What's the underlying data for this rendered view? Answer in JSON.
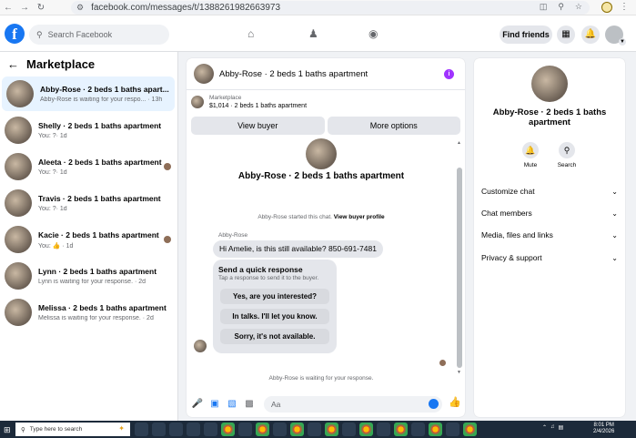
{
  "browser": {
    "url": "facebook.com/messages/t/1388261982663973"
  },
  "header": {
    "search_placeholder": "Search Facebook",
    "find_friends_label": "Find friends"
  },
  "sidebar": {
    "title": "Marketplace",
    "conversations": [
      {
        "name": "Abby-Rose · 2 beds 1 baths apart...",
        "subtitle": "Abby-Rose is waiting for your respo... · 13h",
        "active": true
      },
      {
        "name": "Shelly · 2 beds 1 baths apartment",
        "subtitle": "You: ?· 1d",
        "active": false
      },
      {
        "name": "Aleeta · 2 beds 1 baths apartment",
        "subtitle": "You: ?· 1d",
        "active": false
      },
      {
        "name": "Travis · 2 beds 1 baths apartment",
        "subtitle": "You: ?· 1d",
        "active": false
      },
      {
        "name": "Kacie · 2 beds 1 baths apartment",
        "subtitle": "You: 👍 · 1d",
        "active": false
      },
      {
        "name": "Lynn · 2 beds 1 baths apartment",
        "subtitle": "Lynn is waiting for your response. · 2d",
        "active": false
      },
      {
        "name": "Melissa · 2 beds 1 baths apartment",
        "subtitle": "Melissa is waiting for your response. · 2d",
        "active": false
      }
    ]
  },
  "chat": {
    "header_title": "Abby-Rose · 2 beds 1 baths apartment",
    "marketplace_label": "Marketplace",
    "listing_price": "$1,014 · 2 beds 1 baths apartment",
    "view_buyer_label": "View buyer",
    "more_options_label": "More options",
    "big_title": "Abby-Rose · 2 beds 1 baths apartment",
    "started_text": "Abby-Rose started this chat.",
    "view_buyer_profile_label": "View buyer profile",
    "sender_name": "Abby-Rose",
    "message_text": "Hi Amelie, is this still available? 850-691-7481",
    "quick_title": "Send a quick response",
    "quick_subtitle": "Tap a response to send it to the buyer.",
    "quick_responses": [
      "Yes, are you interested?",
      "In talks. I'll let you know.",
      "Sorry, it's not available."
    ],
    "waiting_text": "Abby-Rose is waiting for your response.",
    "input_placeholder": "Aa"
  },
  "details": {
    "title": "Abby-Rose · 2 beds 1 baths apartment",
    "mute_label": "Mute",
    "search_label": "Search",
    "rows": [
      "Customize chat",
      "Chat members",
      "Media, files and links",
      "Privacy & support"
    ]
  },
  "taskbar": {
    "search_placeholder": "Type here to search",
    "time": "8:01 PM",
    "date": "2/4/2026"
  },
  "colors": {
    "facebook_blue": "#1877f2",
    "active_conversation_bg": "#e7f3ff",
    "info_icon_purple": "#a033ff",
    "taskbar_bg": "#1c2a3a"
  }
}
